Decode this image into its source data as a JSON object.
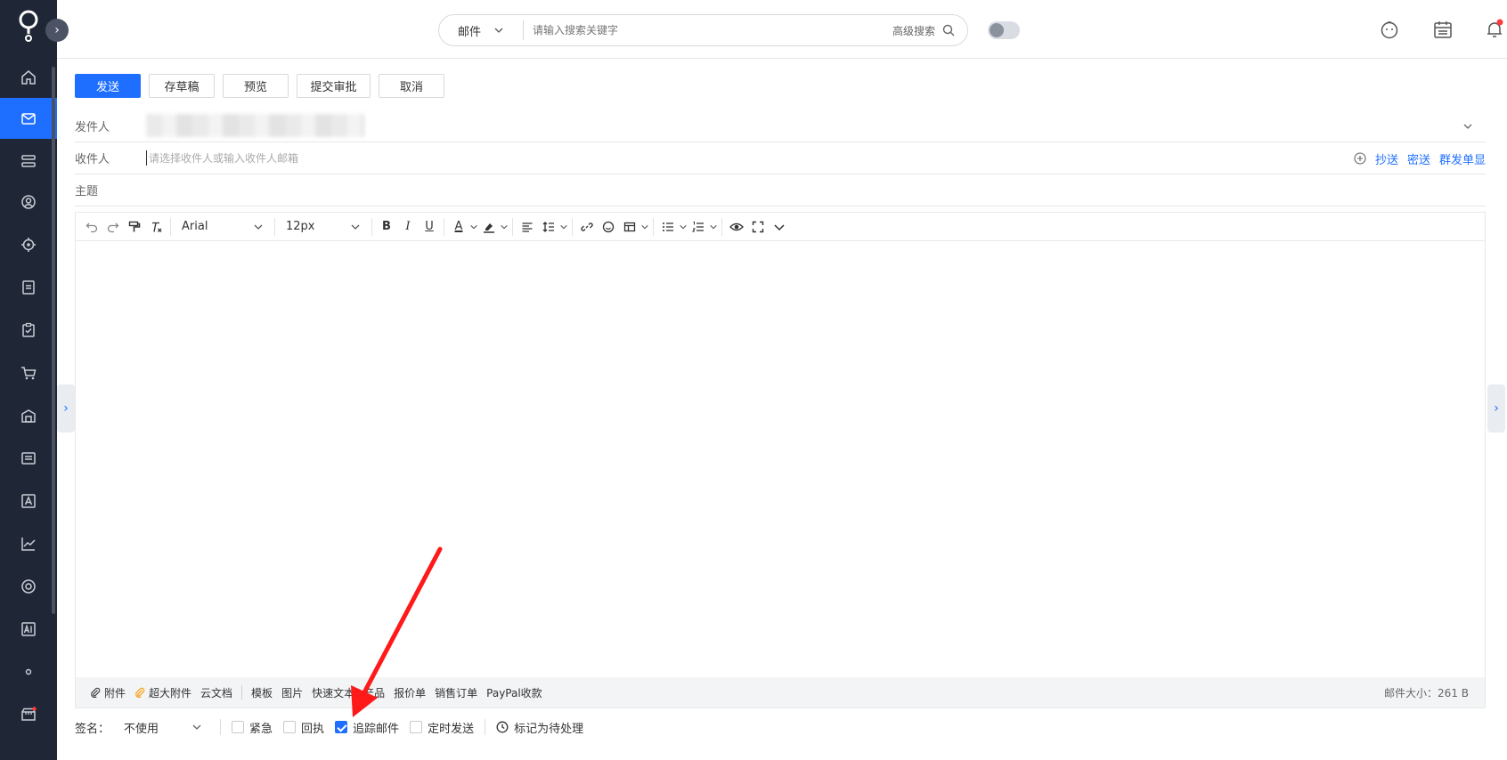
{
  "header": {
    "search_scope": "邮件",
    "search_placeholder": "请输入搜索关键字",
    "advanced_search": "高级搜索"
  },
  "compose": {
    "actions": [
      "发送",
      "存草稿",
      "预览",
      "提交审批",
      "取消"
    ],
    "sender_label": "发件人",
    "recipient_label": "收件人",
    "recipient_placeholder": "请选择收件人或输入收件人邮箱",
    "cc": "抄送",
    "bcc": "密送",
    "separate_send": "群发单显",
    "subject_label": "主题"
  },
  "editor": {
    "font_family": "Arial",
    "font_size": "12px",
    "footer_items": [
      "附件",
      "超大附件",
      "云文档",
      "模板",
      "图片",
      "快速文本",
      "产品",
      "报价单",
      "销售订单",
      "PayPal收款"
    ],
    "mail_size": "邮件大小：261 B"
  },
  "options": {
    "signature_label": "签名：",
    "signature_value": "不使用",
    "urgent": "紧急",
    "receipt": "回执",
    "track": "追踪邮件",
    "scheduled": "定时发送",
    "mark_pending": "标记为待处理",
    "track_checked": true
  },
  "colors": {
    "accent": "#1e6fff",
    "sidebar": "#1f2736",
    "annotation_arrow": "#ff1a1a"
  }
}
